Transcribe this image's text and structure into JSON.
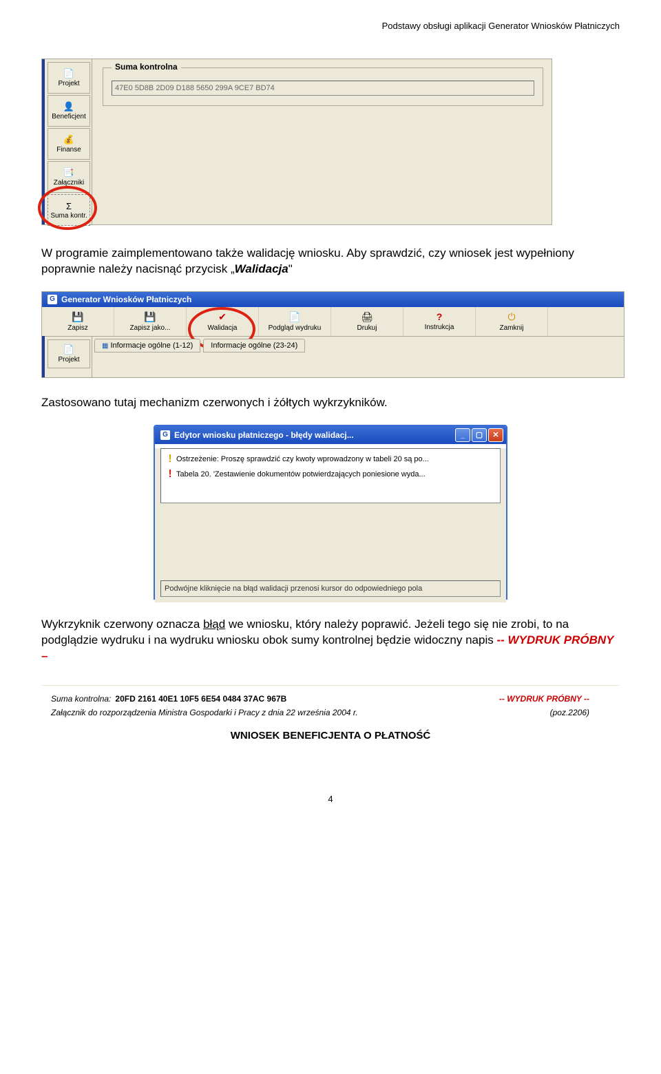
{
  "header": "Podstawy obsługi aplikacji Generator Wniosków Płatniczych",
  "fig1": {
    "tabs": [
      {
        "icon": "📄",
        "label": "Projekt"
      },
      {
        "icon": "👤",
        "label": "Beneficjent"
      },
      {
        "icon": "💰",
        "label": "Finanse"
      },
      {
        "icon": "📑",
        "label": "Załączniki"
      },
      {
        "icon": "Σ",
        "label": "Suma kontr."
      }
    ],
    "group_title": "Suma kontrolna",
    "hash": "47E0 5D8B 2D09 D188 5650 299A 9CE7 BD74"
  },
  "para1_a": "W programie zaimplementowano  także walidację wniosku. Aby sprawdzić, czy wniosek jest wypełniony poprawnie należy nacisnąć przycisk „",
  "para1_b": "Walidacja",
  "para1_c": "\"",
  "fig2": {
    "app_title": "Generator Wniosków Płatniczych",
    "toolbar": [
      {
        "icon": "💾",
        "label": "Zapisz"
      },
      {
        "icon": "💾",
        "label": "Zapisz jako..."
      },
      {
        "icon": "✔",
        "label": "Walidacja",
        "ico_color": "#c00"
      },
      {
        "icon": "📄",
        "label": "Podgląd wydruku"
      },
      {
        "icon": "🖨",
        "label": "Drukuj"
      },
      {
        "icon": "?",
        "label": "Instrukcja",
        "ico_color": "#c00"
      },
      {
        "icon": "⏻",
        "label": "Zamknij",
        "ico_color": "#c80"
      }
    ],
    "side_tab": {
      "icon": "📄",
      "label": "Projekt"
    },
    "info_tabs": [
      "Informacje ogólne (1-12)",
      "Informacje ogólne (23-24)"
    ]
  },
  "para2": "Zastosowano tutaj mechanizm czerwonych i żółtych wykrzykników.",
  "fig3": {
    "title": "Edytor wniosku płatniczego - błędy walidacj...",
    "rows": [
      {
        "type": "yellow",
        "text": "Ostrzeżenie: Proszę sprawdzić czy kwoty wprowadzony w tabeli 20 są po..."
      },
      {
        "type": "red",
        "text": "Tabela 20. 'Zestawienie dokumentów potwierdzających poniesione wyda..."
      }
    ],
    "hint": "Podwójne kliknięcie na błąd walidacji przenosi kursor do odpowiedniego pola"
  },
  "para3_a": "Wykrzyknik czerwony oznacza ",
  "para3_b": "błąd",
  "para3_c": " we wniosku, który należy poprawić. Jeżeli tego się nie zrobi, to na podglądzie wydruku i na wydruku wniosku obok sumy kontrolnej będzie widoczny napis  ",
  "para3_d": "-- WYDRUK PRÓBNY –",
  "fig4": {
    "label": "Suma kontrolna:",
    "hash": "20FD 2161 40E1 10F5 6E54 0484 37AC 967B",
    "probny": "-- WYDRUK PRÓBNY --",
    "line2a": "Załącznik do rozporządzenia Ministra Gospodarki i Pracy z dnia 22 września 2004 r.",
    "line2b": "(poz.2206)",
    "title": "WNIOSEK BENEFICJENTA O PŁATNOŚĆ"
  },
  "page_num": "4"
}
